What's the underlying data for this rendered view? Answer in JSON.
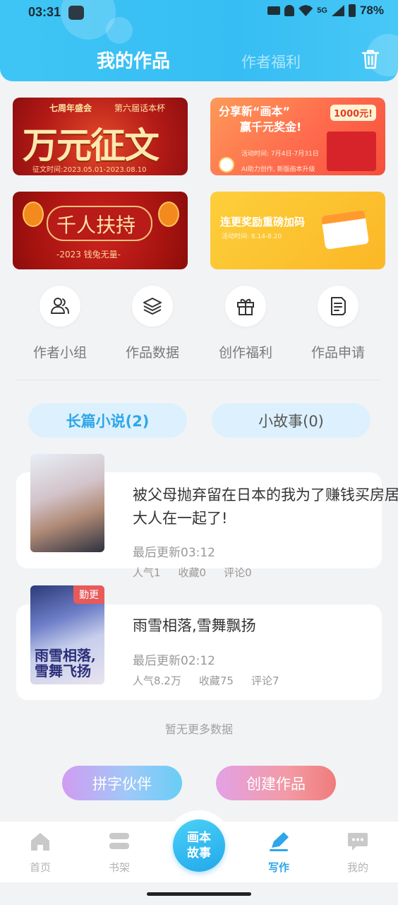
{
  "status_bar": {
    "time": "03:31",
    "battery": "78%",
    "network": "5G"
  },
  "header": {
    "tab_active": "我的作品",
    "tab_inactive": "作者福利",
    "accent_color": "#36bdf3"
  },
  "banners": [
    {
      "tag_left": "七周年盛会",
      "tag_right": "第六届话本杯",
      "title": "万元征文",
      "date": "征文时间:2023.05.01-2023.08.10"
    },
    {
      "line1": "分享新“画本”",
      "line2": "赢千元奖金!",
      "amount": "1000元!",
      "date": "活动时间: 7月4日-7月31日",
      "sub": "AI助力创作, 新版画本升级"
    },
    {
      "title": "千人扶持",
      "sub": "-2023 钱兔无量-"
    },
    {
      "title": "连更奖励重磅加码",
      "date": "活动时间: 8.14-8.20"
    }
  ],
  "quick_actions": [
    {
      "label": "作者小组",
      "icon": "users-icon"
    },
    {
      "label": "作品数据",
      "icon": "layers-icon"
    },
    {
      "label": "创作福利",
      "icon": "gift-icon"
    },
    {
      "label": "作品申请",
      "icon": "document-icon"
    }
  ],
  "tabs": {
    "novel": "长篇小说(2)",
    "story": "小故事(0)"
  },
  "works": [
    {
      "title_line1": "被父母抛弃留在日本的我为了赚钱买房居",
      "title_line2": "大人在一起了!",
      "updated": "最后更新03:12",
      "popularity": "人气1",
      "favorites": "收藏0",
      "comments": "评论0"
    },
    {
      "badge": "勤更",
      "cover_text": "雨雪相落,雪舞飞扬",
      "title_line1": "雨雪相落,雪舞飘扬",
      "updated": "最后更新02:12",
      "popularity": "人气8.2万",
      "favorites": "收藏75",
      "comments": "评论7"
    }
  ],
  "no_more": "暂无更多数据",
  "buttons": {
    "partner": "拼字伙伴",
    "create": "创建作品"
  },
  "bottom_nav": {
    "home": "首页",
    "shelf": "书架",
    "center": "画本故事",
    "write": "写作",
    "mine": "我的"
  }
}
